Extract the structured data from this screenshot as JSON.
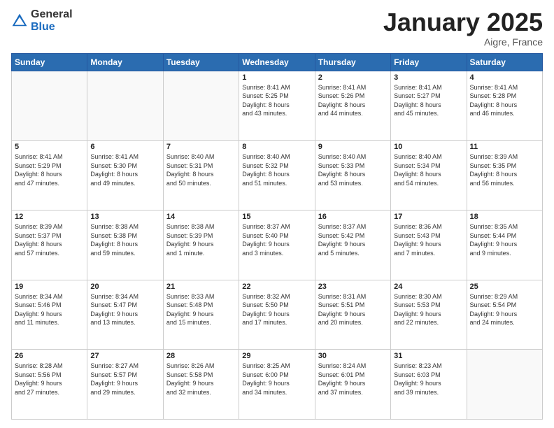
{
  "logo": {
    "general": "General",
    "blue": "Blue"
  },
  "header": {
    "month": "January 2025",
    "location": "Aigre, France"
  },
  "days_of_week": [
    "Sunday",
    "Monday",
    "Tuesday",
    "Wednesday",
    "Thursday",
    "Friday",
    "Saturday"
  ],
  "weeks": [
    [
      {
        "day": "",
        "detail": ""
      },
      {
        "day": "",
        "detail": ""
      },
      {
        "day": "",
        "detail": ""
      },
      {
        "day": "1",
        "detail": "Sunrise: 8:41 AM\nSunset: 5:25 PM\nDaylight: 8 hours\nand 43 minutes."
      },
      {
        "day": "2",
        "detail": "Sunrise: 8:41 AM\nSunset: 5:26 PM\nDaylight: 8 hours\nand 44 minutes."
      },
      {
        "day": "3",
        "detail": "Sunrise: 8:41 AM\nSunset: 5:27 PM\nDaylight: 8 hours\nand 45 minutes."
      },
      {
        "day": "4",
        "detail": "Sunrise: 8:41 AM\nSunset: 5:28 PM\nDaylight: 8 hours\nand 46 minutes."
      }
    ],
    [
      {
        "day": "5",
        "detail": "Sunrise: 8:41 AM\nSunset: 5:29 PM\nDaylight: 8 hours\nand 47 minutes."
      },
      {
        "day": "6",
        "detail": "Sunrise: 8:41 AM\nSunset: 5:30 PM\nDaylight: 8 hours\nand 49 minutes."
      },
      {
        "day": "7",
        "detail": "Sunrise: 8:40 AM\nSunset: 5:31 PM\nDaylight: 8 hours\nand 50 minutes."
      },
      {
        "day": "8",
        "detail": "Sunrise: 8:40 AM\nSunset: 5:32 PM\nDaylight: 8 hours\nand 51 minutes."
      },
      {
        "day": "9",
        "detail": "Sunrise: 8:40 AM\nSunset: 5:33 PM\nDaylight: 8 hours\nand 53 minutes."
      },
      {
        "day": "10",
        "detail": "Sunrise: 8:40 AM\nSunset: 5:34 PM\nDaylight: 8 hours\nand 54 minutes."
      },
      {
        "day": "11",
        "detail": "Sunrise: 8:39 AM\nSunset: 5:35 PM\nDaylight: 8 hours\nand 56 minutes."
      }
    ],
    [
      {
        "day": "12",
        "detail": "Sunrise: 8:39 AM\nSunset: 5:37 PM\nDaylight: 8 hours\nand 57 minutes."
      },
      {
        "day": "13",
        "detail": "Sunrise: 8:38 AM\nSunset: 5:38 PM\nDaylight: 8 hours\nand 59 minutes."
      },
      {
        "day": "14",
        "detail": "Sunrise: 8:38 AM\nSunset: 5:39 PM\nDaylight: 9 hours\nand 1 minute."
      },
      {
        "day": "15",
        "detail": "Sunrise: 8:37 AM\nSunset: 5:40 PM\nDaylight: 9 hours\nand 3 minutes."
      },
      {
        "day": "16",
        "detail": "Sunrise: 8:37 AM\nSunset: 5:42 PM\nDaylight: 9 hours\nand 5 minutes."
      },
      {
        "day": "17",
        "detail": "Sunrise: 8:36 AM\nSunset: 5:43 PM\nDaylight: 9 hours\nand 7 minutes."
      },
      {
        "day": "18",
        "detail": "Sunrise: 8:35 AM\nSunset: 5:44 PM\nDaylight: 9 hours\nand 9 minutes."
      }
    ],
    [
      {
        "day": "19",
        "detail": "Sunrise: 8:34 AM\nSunset: 5:46 PM\nDaylight: 9 hours\nand 11 minutes."
      },
      {
        "day": "20",
        "detail": "Sunrise: 8:34 AM\nSunset: 5:47 PM\nDaylight: 9 hours\nand 13 minutes."
      },
      {
        "day": "21",
        "detail": "Sunrise: 8:33 AM\nSunset: 5:48 PM\nDaylight: 9 hours\nand 15 minutes."
      },
      {
        "day": "22",
        "detail": "Sunrise: 8:32 AM\nSunset: 5:50 PM\nDaylight: 9 hours\nand 17 minutes."
      },
      {
        "day": "23",
        "detail": "Sunrise: 8:31 AM\nSunset: 5:51 PM\nDaylight: 9 hours\nand 20 minutes."
      },
      {
        "day": "24",
        "detail": "Sunrise: 8:30 AM\nSunset: 5:53 PM\nDaylight: 9 hours\nand 22 minutes."
      },
      {
        "day": "25",
        "detail": "Sunrise: 8:29 AM\nSunset: 5:54 PM\nDaylight: 9 hours\nand 24 minutes."
      }
    ],
    [
      {
        "day": "26",
        "detail": "Sunrise: 8:28 AM\nSunset: 5:56 PM\nDaylight: 9 hours\nand 27 minutes."
      },
      {
        "day": "27",
        "detail": "Sunrise: 8:27 AM\nSunset: 5:57 PM\nDaylight: 9 hours\nand 29 minutes."
      },
      {
        "day": "28",
        "detail": "Sunrise: 8:26 AM\nSunset: 5:58 PM\nDaylight: 9 hours\nand 32 minutes."
      },
      {
        "day": "29",
        "detail": "Sunrise: 8:25 AM\nSunset: 6:00 PM\nDaylight: 9 hours\nand 34 minutes."
      },
      {
        "day": "30",
        "detail": "Sunrise: 8:24 AM\nSunset: 6:01 PM\nDaylight: 9 hours\nand 37 minutes."
      },
      {
        "day": "31",
        "detail": "Sunrise: 8:23 AM\nSunset: 6:03 PM\nDaylight: 9 hours\nand 39 minutes."
      },
      {
        "day": "",
        "detail": ""
      }
    ]
  ]
}
